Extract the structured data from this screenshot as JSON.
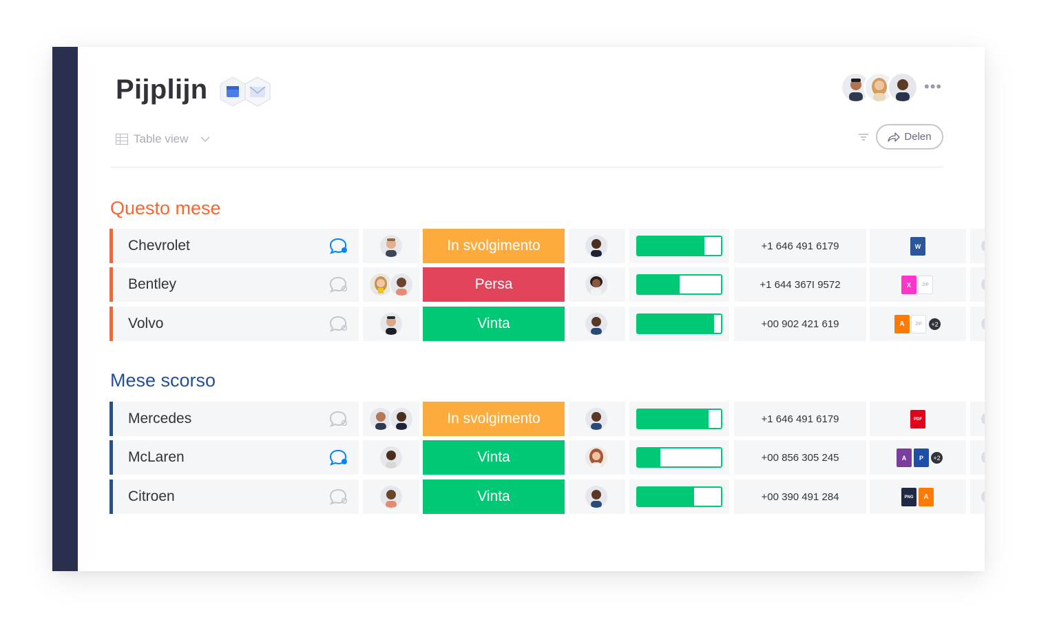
{
  "board": {
    "title": "Pijplijn",
    "view_label": "Table view",
    "share_label": "Delen",
    "more_label": "•••"
  },
  "colors": {
    "sidebar": "#292f4c",
    "group1": "#ff642e",
    "group2": "#225091",
    "status_working": "#fdab3d",
    "status_lost": "#e2445c",
    "status_won": "#00c875"
  },
  "groups": [
    {
      "title": "Questo mese",
      "color": "#ff642e",
      "rows": [
        {
          "name": "Chevrolet",
          "chat_active": true,
          "status": "In svolgimento",
          "status_color": "#fdab3d",
          "progress": 0.8,
          "phone": "+1 646 491 6179",
          "files": [
            "W"
          ]
        },
        {
          "name": "Bentley",
          "chat_active": false,
          "status": "Persa",
          "status_color": "#e2445c",
          "progress": 0.5,
          "phone": "+1 644 367I 9572",
          "files": [
            "X",
            "ZIP"
          ]
        },
        {
          "name": "Volvo",
          "chat_active": false,
          "status": "Vinta",
          "status_color": "#00c875",
          "progress": 0.92,
          "phone": "+00 902 421 619",
          "files": [
            "A",
            "ZIP",
            "+2"
          ]
        }
      ]
    },
    {
      "title": "Mese scorso",
      "color": "#225091",
      "rows": [
        {
          "name": "Mercedes",
          "chat_active": false,
          "status": "In svolgimento",
          "status_color": "#fdab3d",
          "progress": 0.85,
          "phone": "+1 646 491 6179",
          "files": [
            "PDF"
          ]
        },
        {
          "name": "McLaren",
          "chat_active": true,
          "status": "Vinta",
          "status_color": "#00c875",
          "progress": 0.27,
          "phone": "+00 856 305 245",
          "files": [
            "A",
            "P",
            "+2"
          ]
        },
        {
          "name": "Citroen",
          "chat_active": false,
          "status": "Vinta",
          "status_color": "#00c875",
          "progress": 0.68,
          "phone": "+00 390 491 284",
          "files": [
            "PNG",
            "A"
          ]
        }
      ]
    }
  ]
}
